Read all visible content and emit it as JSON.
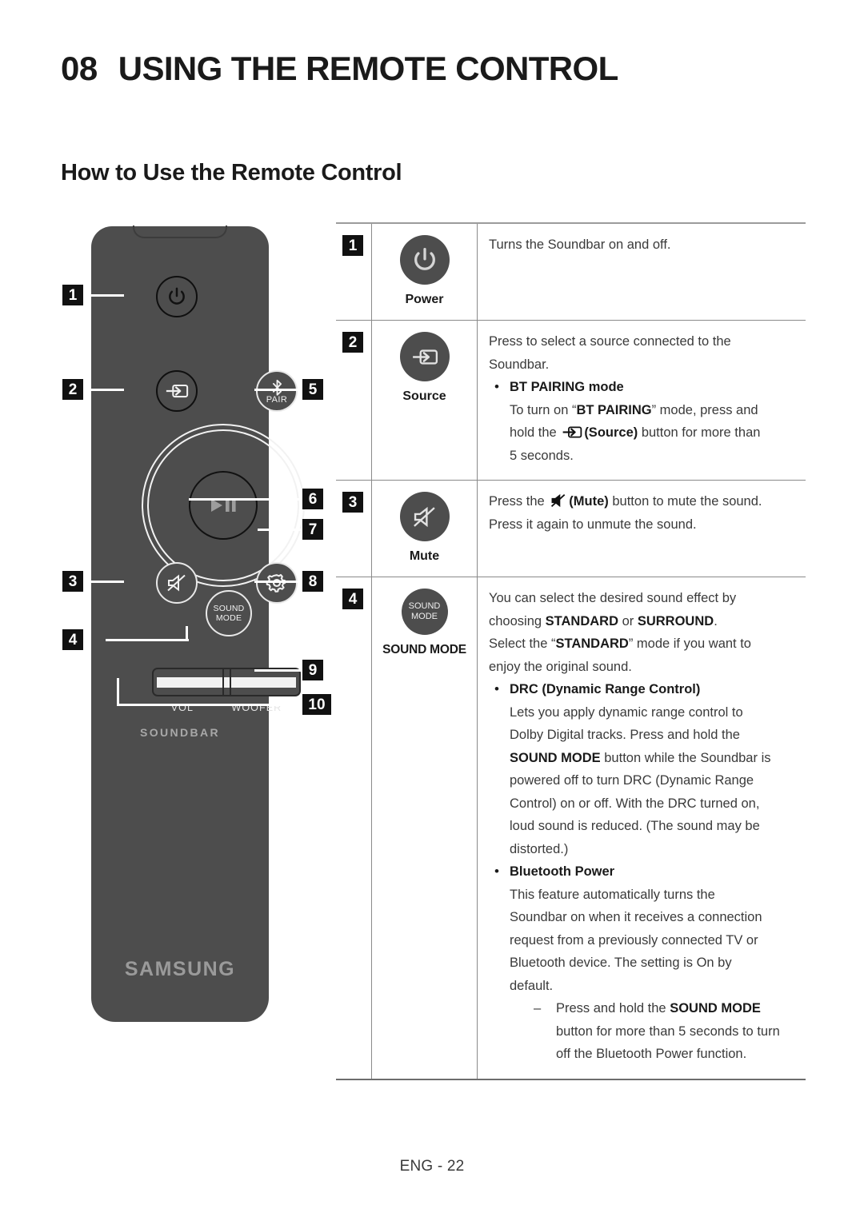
{
  "header": {
    "chapter_number": "08",
    "chapter_title": "USING THE REMOTE CONTROL",
    "section_title": "How to Use the Remote Control"
  },
  "remote": {
    "brand": "SAMSUNG",
    "product_word": "SOUNDBAR",
    "pair_label": "PAIR",
    "sound_mode_line1": "SOUND",
    "sound_mode_line2": "MODE",
    "vol_label": "VOL",
    "woofer_label": "WOOFER",
    "callouts": [
      {
        "number": "1",
        "target": "power-button"
      },
      {
        "number": "2",
        "target": "source-button"
      },
      {
        "number": "3",
        "target": "mute-button"
      },
      {
        "number": "4",
        "target": "sound-mode-button"
      },
      {
        "number": "5",
        "target": "bluetooth-pair-button"
      },
      {
        "number": "6",
        "target": "play-pause-button"
      },
      {
        "number": "7",
        "target": "navigation-wheel"
      },
      {
        "number": "8",
        "target": "settings-button"
      },
      {
        "number": "9",
        "target": "volume-woofer-rocker"
      },
      {
        "number": "10",
        "target": "volume-control"
      }
    ]
  },
  "table": {
    "rows": [
      {
        "number": "1",
        "icon": "power-icon",
        "button_label": "Power",
        "description_plain": "Turns the Soundbar on and off."
      },
      {
        "number": "2",
        "icon": "source-icon",
        "button_label": "Source",
        "intro_line1": "Press to select a source connected to the",
        "intro_line2": "Soundbar.",
        "bullets": [
          {
            "title": "BT PAIRING mode",
            "body_a": "To turn on “",
            "body_b": "BT PAIRING",
            "body_c": "” mode, press and",
            "body_d": "hold the ",
            "body_e": "(Source)",
            "body_f": " button for more than",
            "body_g": "5 seconds."
          }
        ]
      },
      {
        "number": "3",
        "icon": "mute-icon",
        "button_label": "Mute",
        "desc_a": "Press the ",
        "desc_b": "(Mute)",
        "desc_c": " button to mute the sound.",
        "desc_d": "Press it again to unmute the sound."
      },
      {
        "number": "4",
        "icon": "sound-mode-icon",
        "button_label": "SOUND MODE",
        "button_icon_line1": "SOUND",
        "button_icon_line2": "MODE",
        "intro": {
          "line1_a": "You can select the desired sound effect by",
          "line2_a": "choosing ",
          "line2_b": "STANDARD",
          "line2_c": " or ",
          "line2_d": "SURROUND",
          "line2_e": ".",
          "line3_a": "Select the “",
          "line3_b": "STANDARD",
          "line3_c": "” mode if you want to",
          "line4_a": "enjoy the original sound."
        },
        "bullets": [
          {
            "title": "DRC (Dynamic Range Control)",
            "l1": "Lets you apply dynamic range control to",
            "l2": "Dolby Digital tracks. Press and hold the",
            "l3_b": "SOUND MODE",
            "l3_a": " button while the Soundbar is",
            "l4": "powered off to turn DRC (Dynamic Range",
            "l5": "Control) on or off. With the DRC turned on,",
            "l6": "loud sound is reduced. (The sound may be",
            "l7": "distorted.)"
          },
          {
            "title": "Bluetooth Power",
            "l1": "This feature automatically turns the",
            "l2": "Soundbar on when it receives a connection",
            "l3": "request from a previously connected TV or",
            "l4": "Bluetooth device. The setting is On by",
            "l5": "default.",
            "sub": {
              "d1_a": "Press and hold the ",
              "d1_b": "SOUND MODE",
              "d2": "button for more than 5 seconds to turn",
              "d3": "off the Bluetooth Power function."
            }
          }
        ]
      }
    ]
  },
  "footer": {
    "page_label": "ENG - 22"
  },
  "colors": {
    "remote_body": "#4d4d4d",
    "badge_bg": "#111111",
    "rule": "#8a8a8a",
    "text": "#3a3a3a"
  }
}
